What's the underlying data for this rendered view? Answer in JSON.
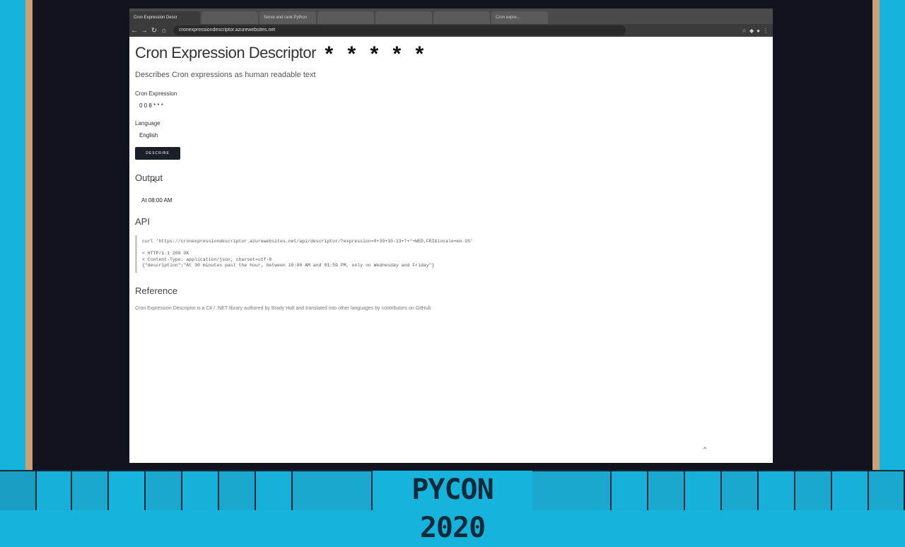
{
  "browser": {
    "tabs": [
      "Cron Expression Descr",
      "",
      "Serve and rank Python",
      "",
      "",
      "",
      "Cron expre…"
    ],
    "url": "cronexpressiondescriptor.azurewebsites.net"
  },
  "page": {
    "title": "Cron Expression Descriptor",
    "stars": "* * * * *",
    "subtitle": "Describes Cron expressions as human readable text",
    "cron_label": "Cron Expression",
    "cron_value": "0 0 8 * * *",
    "language_label": "Language",
    "language_value": "English",
    "describe_button": "DESCRIBE",
    "output_heading": "Output",
    "output_text": "At 08:00 AM",
    "api_heading": "API",
    "api_lines": [
      "curl 'https://cronexpressiondescriptor.azurewebsites.net/api/descriptor/?expression=0+30+10-13+?+*+WED,FRI&locale=en-US'",
      "",
      "< HTTP/1.1 200 OK",
      "< Content-Type: application/json; charset=utf-8",
      "{\"description\":\"At 30 minutes past the hour, between 10:00 AM and 01:59 PM, only on Wednesday and Friday\"}"
    ],
    "reference_heading": "Reference",
    "reference_text": "Cron Expression Descriptor is a C# / .NET library authored by Brady Holt and translated into other languages by contributors on GitHub"
  },
  "banner": {
    "text": "PYCON 2020"
  },
  "colors": {
    "background": "#16b3dc",
    "frame": "#13121f",
    "button": "#1b1f2a"
  }
}
